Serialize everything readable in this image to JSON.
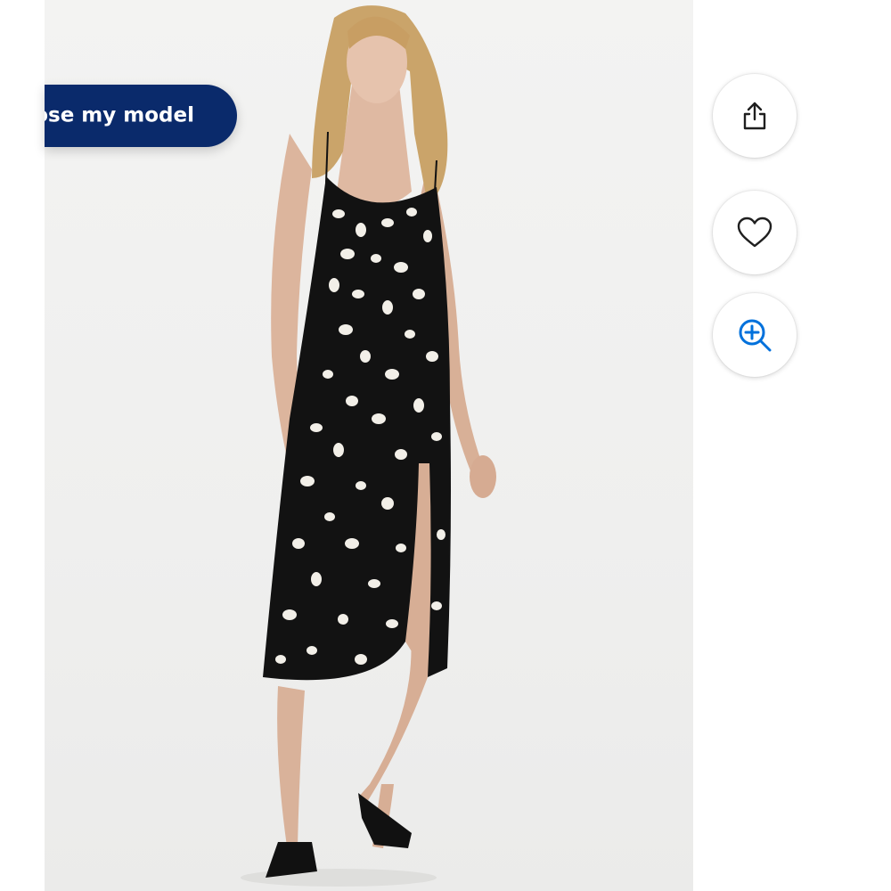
{
  "model_panel": {
    "choose_model_label": "Choose my model"
  },
  "actions": {
    "share_icon": "share-icon",
    "favorite_icon": "heart-icon",
    "zoom_icon": "zoom-in-icon"
  },
  "colors": {
    "brand_blue": "#0a2a6b",
    "icon_dark": "#1f1f1f",
    "zoom_blue": "#0071dc"
  }
}
